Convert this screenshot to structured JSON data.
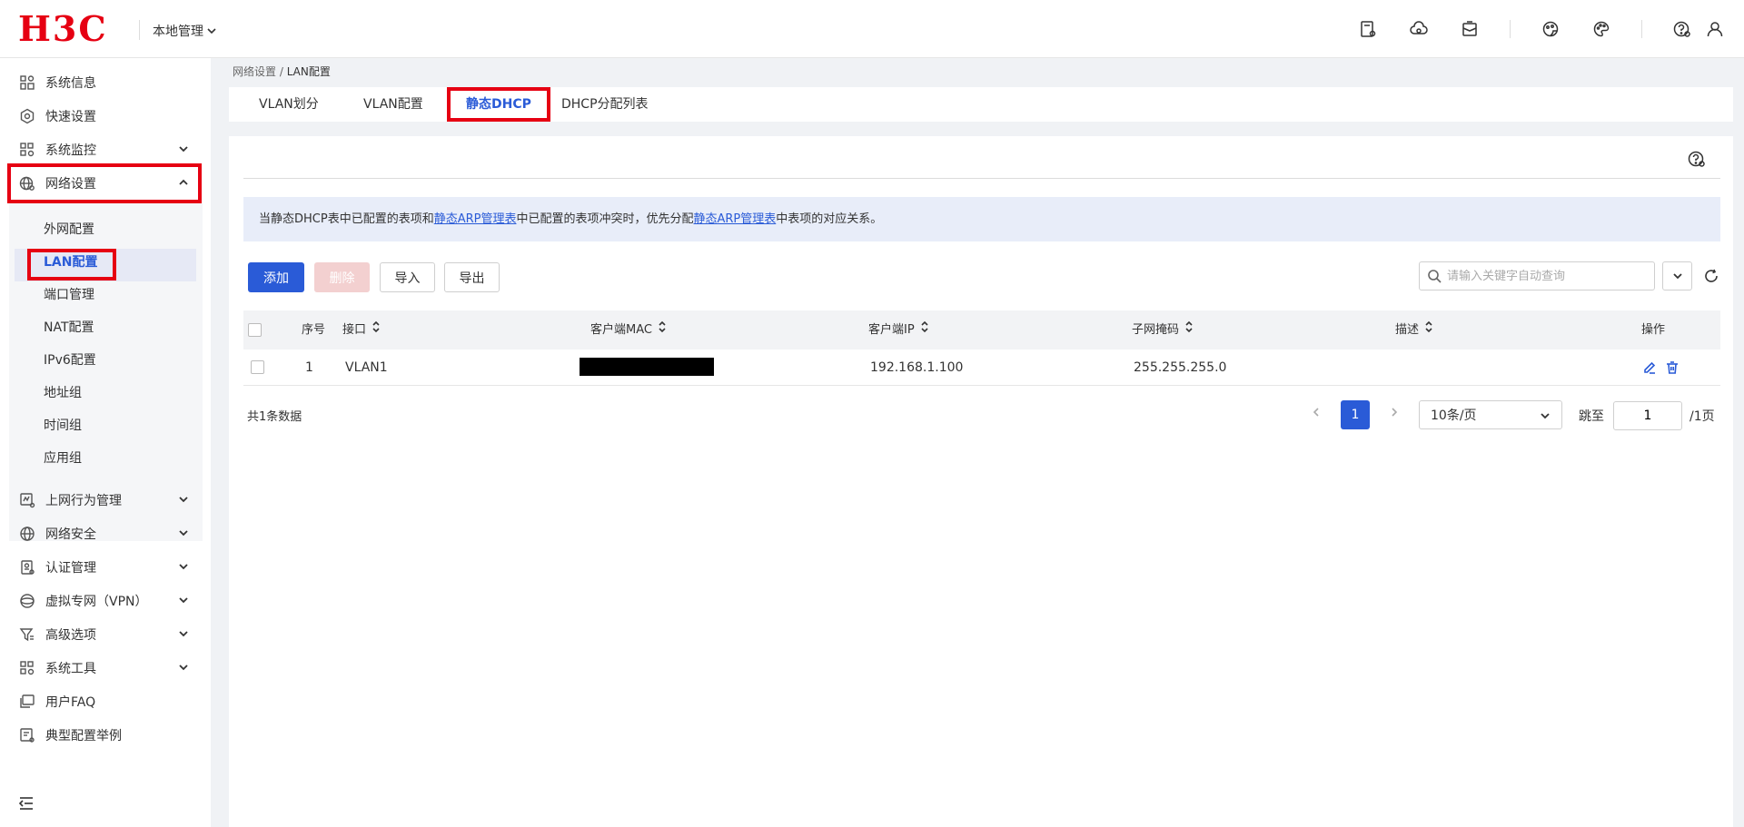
{
  "header": {
    "logo_text": "H3C",
    "local_mgmt": "本地管理",
    "icons": [
      "device-add-icon",
      "cloud-sync-icon",
      "mailbox-icon",
      "theme-dark-icon",
      "palette-icon",
      "help-icon",
      "user-icon"
    ]
  },
  "sidebar": {
    "items": [
      {
        "label": "系统信息",
        "icon": "dashboard-icon"
      },
      {
        "label": "快速设置",
        "icon": "settings-hex-icon"
      },
      {
        "label": "系统监控",
        "icon": "monitor-icon"
      },
      {
        "label": "网络设置",
        "icon": "globe-gear-icon"
      },
      {
        "label": "上网行为管理",
        "icon": "behavior-icon"
      },
      {
        "label": "网络安全",
        "icon": "globe-shield-icon"
      },
      {
        "label": "认证管理",
        "icon": "cert-icon"
      },
      {
        "label": "虚拟专网（VPN）",
        "icon": "vpn-icon"
      },
      {
        "label": "高级选项",
        "icon": "filter-icon"
      },
      {
        "label": "系统工具",
        "icon": "tools-icon"
      },
      {
        "label": "用户FAQ",
        "icon": "faq-icon"
      },
      {
        "label": "典型配置举例",
        "icon": "example-icon"
      }
    ],
    "sub_items": [
      "外网配置",
      "LAN配置",
      "端口管理",
      "NAT配置",
      "IPv6配置",
      "地址组",
      "时间组",
      "应用组"
    ]
  },
  "breadcrumb": {
    "parent": "网络设置",
    "sep": " / ",
    "current": "LAN配置"
  },
  "tabs": [
    "VLAN划分",
    "VLAN配置",
    "静态DHCP",
    "DHCP分配列表"
  ],
  "notice": {
    "part1": "当静态DHCP表中已配置的表项和",
    "link1": "静态ARP管理表",
    "part2": "中已配置的表项冲突时，优先分配",
    "link2": "静态ARP管理表",
    "part3": "中表项的对应关系。"
  },
  "toolbar": {
    "add": "添加",
    "delete": "删除",
    "import": "导入",
    "export": "导出",
    "search_placeholder": "请输入关键字自动查询"
  },
  "table": {
    "columns": [
      "序号",
      "接口",
      "客户端MAC",
      "客户端IP",
      "子网掩码",
      "描述",
      "操作"
    ],
    "rows": [
      {
        "index": "1",
        "interface": "VLAN1",
        "mac": "",
        "ip": "192.168.1.100",
        "mask": "255.255.255.0",
        "desc": ""
      }
    ]
  },
  "pagination": {
    "total": "共1条数据",
    "current": "1",
    "page_size": "10条/页",
    "jump_label": "跳至",
    "jump_value": "1",
    "page_total": "/1页"
  }
}
